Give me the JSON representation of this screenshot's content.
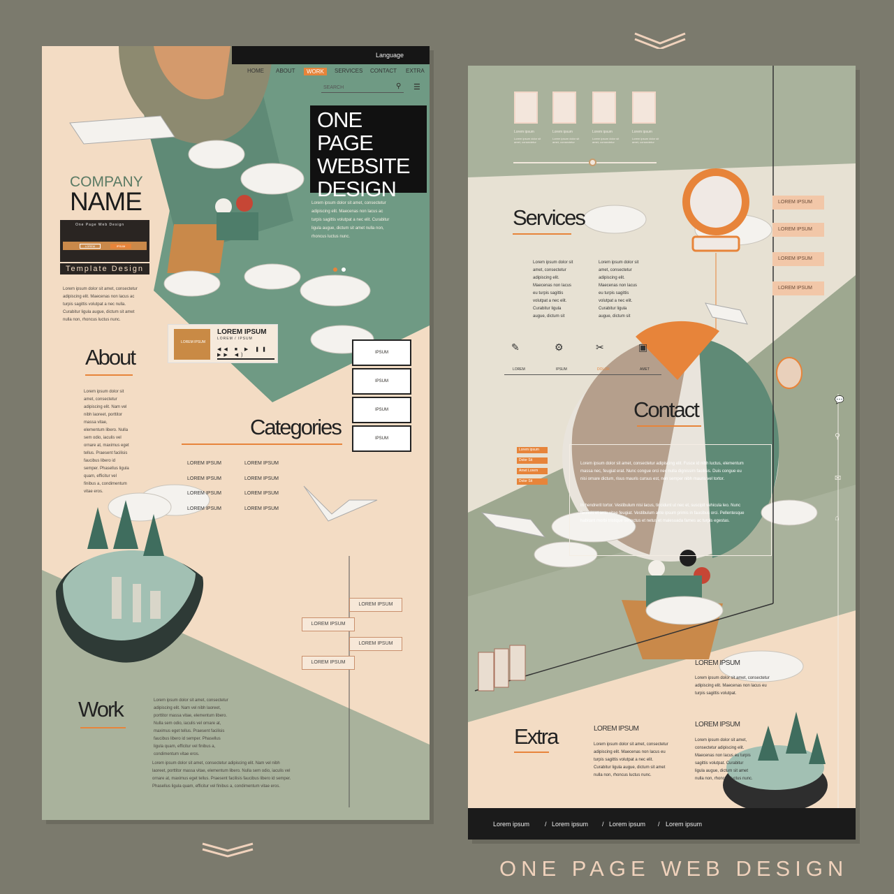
{
  "caption": "ONE PAGE WEB DESIGN",
  "colors": {
    "background": "#7b7a6d",
    "peach": "#f3dcc4",
    "sage": "#a9b29c",
    "green": "#5f8a76",
    "orange": "#e7843a",
    "dark": "#161616"
  },
  "left_page": {
    "language": "Language",
    "nav": [
      "HOME",
      "ABOUT",
      "WORK",
      "SERVICES",
      "CONTACT",
      "EXTRA"
    ],
    "nav_active": "WORK",
    "search_placeholder": "SEARCH",
    "hero_title": [
      "ONE PAGE",
      "WEBSITE",
      "DESIGN"
    ],
    "hero_text": "Lorem ipsum dolor sit amet, consectetur adipiscing elit. Maecenas non lacus ac turpis sagittis volutpat a nec elit. Curabitur ligula augue, dictum sit amet nulla non, rhoncus luctus nunc.",
    "company": "COMPANY",
    "name": "NAME",
    "logo_tagline": "One Page Web Design",
    "logo_btn1": "LOREM",
    "logo_btn2": "IPSUM",
    "template": "Template Design",
    "intro_text": "Lorem ipsum dolor sit amet, consectetur adipiscing elit. Maecenas non lacus ac turpis sagittis volutpat a nec nulla. Curabitur ligula augue, dictum sit amet nulla non, rhoncus luctus nunc.",
    "about": {
      "title": "About",
      "text": "Lorem ipsum dolor sit amet, consectetur adipiscing elit. Nam vel nibh laoreet, porttitor massa vitae, elementum libero. Nulla sem odio, iaculis vel ornare at, maximus eget tellus. Praesent facilisis faucibus libero id semper. Phasellus ligula quam, efficitur vel finibus a, condimentum vitae eros."
    },
    "player": {
      "title": "LOREM IPSUM",
      "subtitle": "LOREM / IPSUM",
      "thumb": "LOREM IPSUM",
      "controls": "◀◀ ■ ▶ ❚❚ ▶▶ ◀)"
    },
    "side_buttons": [
      "IPSUM",
      "IPSUM",
      "IPSUM",
      "IPSUM"
    ],
    "categories": {
      "title": "Categories",
      "items": [
        "LOREM IPSUM",
        "LOREM IPSUM",
        "LOREM IPSUM",
        "LOREM IPSUM",
        "LOREM IPSUM",
        "LOREM IPSUM",
        "LOREM IPSUM",
        "LOREM IPSUM"
      ]
    },
    "signs": [
      "LOREM IPSUM",
      "LOREM IPSUM",
      "LOREM IPSUM",
      "LOREM IPSUM"
    ],
    "work": {
      "title": "Work",
      "text1": "Lorem ipsum dolor sit amet, consectetur adipiscing elit. Nam vel nibh laoreet, porttitor massa vitae, elementum libero. Nulla sem odio, iaculis vel ornare at, maximus eget tellus. Praesent facilisis faucibus libero id semper. Phasellus ligula quam, efficitur vel finibus a, condimentum vitae eros.",
      "text2": "Lorem ipsum dolor sit amet, consectetur adipiscing elit. Nam vel nibh laoreet, porttitor massa vitae, elementum libero. Nulla sem odio, iaculis vel ornare at, maximus eget tellus. Praesent facilisis faucibus libero id semper. Phasellus ligula quam, efficitur vel finibus a, condimentum vitae eros."
    }
  },
  "right_page": {
    "thumb_labels": [
      "Lorem ipsum",
      "Lorem ipsum",
      "Lorem ipsum",
      "Lorem ipsum"
    ],
    "thumb_text": "Lorem ipsum dolor sit amet, consectetur",
    "services": {
      "title": "Services",
      "col1": "Lorem ipsum dolor sit amet, consectetur adipiscing elit. Maecenas non lacus eu turpis sagittis volutpat a nec elit. Curabitur ligula augue, dictum sit",
      "col2": "Lorem ipsum dolor sit amet, consectetur adipiscing elit. Maecenas non lacus eu turpis sagittis volutpat a nec elit. Curabitur ligula augue, dictum sit",
      "labels": [
        "LOREM",
        "IPSUM",
        "DOLOR",
        "AMET"
      ],
      "icons": [
        "✎",
        "⚙",
        "✂",
        "▣"
      ]
    },
    "side_signs": [
      "LOREM IPSUM",
      "LOREM IPSUM",
      "LOREM IPSUM",
      "LOREM IPSUM"
    ],
    "side_icons": [
      "chat-icon",
      "search-icon",
      "mail-icon",
      "home-icon"
    ],
    "side_glyphs": [
      "💬",
      "⚲",
      "✉",
      "⌂"
    ],
    "contact": {
      "title": "Contact",
      "tags": [
        "Lorem ipsum",
        "Dolor Sit",
        "Amet Lorem",
        "Dolor Sit"
      ],
      "text1": "Lorem ipsum dolor sit amet, consectetur adipiscing elit. Fusce id nibh luctus, elementum massa nec, feugiat erat. Nunc congue orci nec nulla dignissim facilisis. Duis congue eu nisi ornare dictum, risus mauris cursus est, non semper nibh mauris vel tortor.",
      "text2": "In hendrerit tortor. Vestibulum nisi lacus, tincidunt ut nec et, suscipit vehicula leo. Nunc facilisis et ante vitae feugiat. Vestibulum ante ipsum primis in faucibus orci. Pellentesque habitant morbi tristique senectus et netus et malesuada fames ac turpis egestas."
    },
    "extra": {
      "title": "Extra",
      "col_a_title": "LOREM IPSUM",
      "col_a_text": "Lorem ipsum dolor sit amet, consectetur adipiscing elit. Maecenas non lacus eu turpis sagittis volutpat a nec elit. Curabitur ligula augue, dictum sit amet nulla non, rhoncus luctus nunc.",
      "col_b_title": "LOREM IPSUM",
      "col_b_text": "Lorem ipsum dolor sit amet, consectetur adipiscing elit. Maecenas non lacus eu turpis sagittis volutpat. Curabitur ligula augue, dictum sit amet nulla non, rhoncus luctus nunc.",
      "top_title": "LOREM IPSUM",
      "top_text": "Lorem ipsum dolor sit amet, consectetur adipiscing elit. Maecenas non lacus eu turpis sagittis volutpat."
    },
    "footer": [
      "Lorem ipsum",
      "Lorem ipsum",
      "Lorem ipsum",
      "Lorem ipsum"
    ],
    "footer_sep": "/"
  }
}
